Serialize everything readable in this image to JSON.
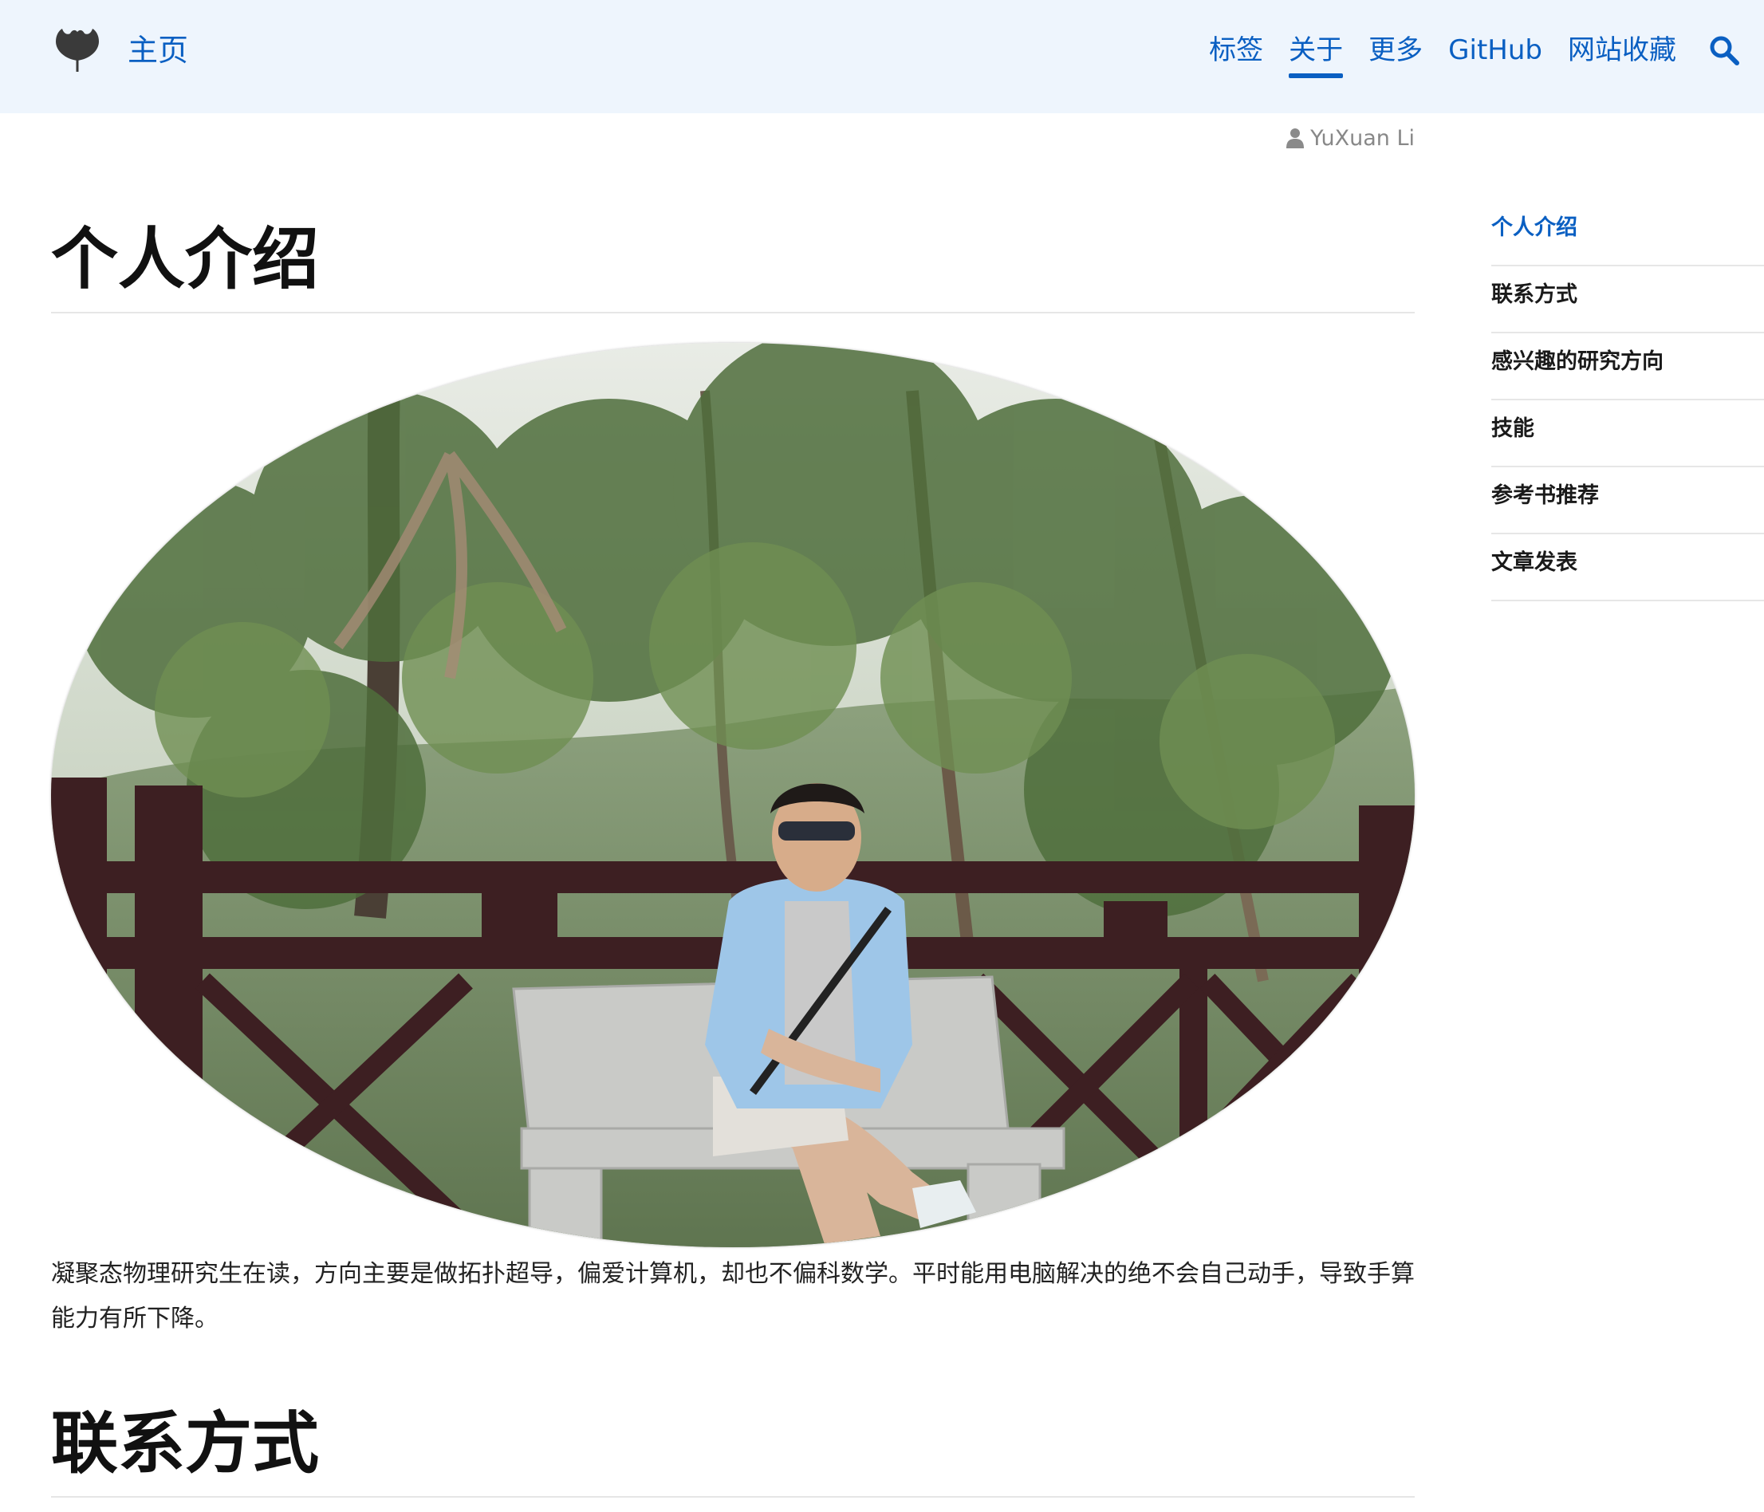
{
  "header": {
    "brand_title": "主页",
    "nav": [
      {
        "label": "标签",
        "active": false
      },
      {
        "label": "关于",
        "active": true
      },
      {
        "label": "更多",
        "active": false
      },
      {
        "label": "GitHub",
        "active": false
      },
      {
        "label": "网站收藏",
        "active": false
      }
    ],
    "search_icon": "search-icon",
    "logo_icon": "ginkgo-leaf-logo"
  },
  "article": {
    "author": "YuXuan Li",
    "sections": [
      {
        "heading": "个人介绍"
      },
      {
        "heading": "联系方式"
      }
    ],
    "intro_text": "凝聚态物理研究生在读，方向主要是做拓扑超导，偏爱计算机，却也不偏科数学。平时能用电脑解决的绝不会自己动手，导致手算能力有所下降。"
  },
  "toc": {
    "items": [
      {
        "label": "个人介绍",
        "active": true
      },
      {
        "label": "联系方式",
        "active": false
      },
      {
        "label": "感兴趣的研究方向",
        "active": false
      },
      {
        "label": "技能",
        "active": false
      },
      {
        "label": "参考书推荐",
        "active": false
      },
      {
        "label": "文章发表",
        "active": false
      }
    ]
  },
  "colors": {
    "header_bg": "#eef5fd",
    "accent": "#0a5fc2",
    "text": "#222222",
    "muted": "#888888"
  }
}
